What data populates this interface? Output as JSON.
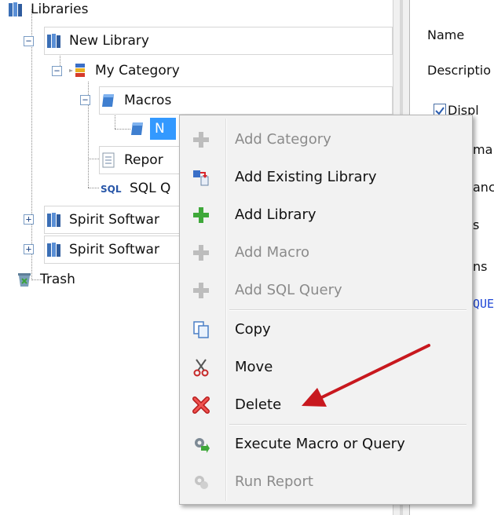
{
  "tree": {
    "root_label": "Libraries",
    "new_library_label": "New Library",
    "category_label": "My Category",
    "macros_label": "Macros",
    "selected_macro_label": "N",
    "reports_label": "Repor",
    "sql_label": "SQL Q",
    "spirit1_label": "Spirit Softwar",
    "spirit2_label": "Spirit Softwar",
    "trash_label": "Trash"
  },
  "properties": {
    "name_label": "Name",
    "description_label": "Descriptio",
    "display_label": "Displ",
    "row4": "ma",
    "row5": "anc",
    "row6": "s",
    "row7": "ns",
    "code_text": "QUE"
  },
  "context_menu": {
    "items": [
      {
        "label": "Add Category",
        "icon": "plus-icon",
        "disabled": true
      },
      {
        "label": "Add Existing Library",
        "icon": "existing-library-icon",
        "disabled": false
      },
      {
        "label": "Add Library",
        "icon": "plus-icon",
        "disabled": false
      },
      {
        "label": "Add Macro",
        "icon": "plus-icon",
        "disabled": true
      },
      {
        "label": "Add SQL Query",
        "icon": "plus-icon",
        "disabled": true
      },
      {
        "label": "Copy",
        "icon": "copy-icon",
        "disabled": false
      },
      {
        "label": "Move",
        "icon": "scissors-icon",
        "disabled": false
      },
      {
        "label": "Delete",
        "icon": "delete-x-icon",
        "disabled": false
      },
      {
        "label": "Execute Macro or Query",
        "icon": "execute-gear-icon",
        "disabled": false
      },
      {
        "label": "Run Report",
        "icon": "run-report-gear-icon",
        "disabled": true
      }
    ]
  },
  "annotation": {
    "arrow_color": "#c8181e",
    "points_to": "Delete"
  },
  "colors": {
    "selection": "#3399ff",
    "plus_green": "#3fa83a",
    "plus_gray": "#bdbdbd",
    "delete_red": "#d9262c"
  }
}
